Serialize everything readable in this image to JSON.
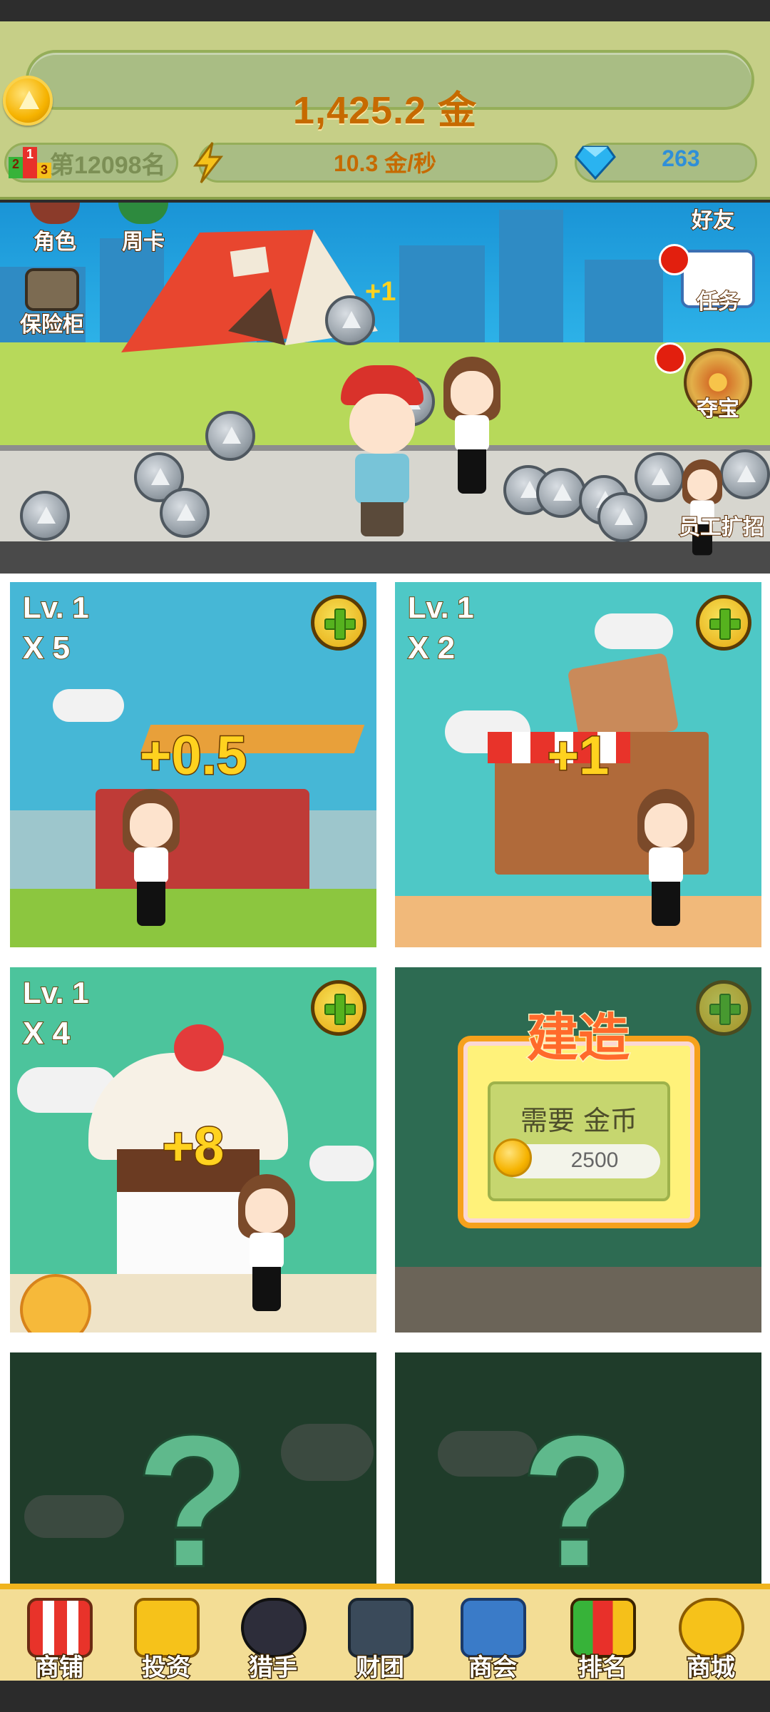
{
  "hud": {
    "coins": "1,425.2 金",
    "rank": "第12098名",
    "rank_badges": [
      "2",
      "1",
      "3"
    ],
    "speed": "10.3 金/秒",
    "gems": "263"
  },
  "scene": {
    "buttons": {
      "role": "角色",
      "weekly_card": "周卡",
      "safe": "保险柜",
      "friends": "好友",
      "tasks": "任务",
      "treasure": "夺宝",
      "recruit": "员工扩招"
    },
    "floating_gain": "+1"
  },
  "tiles": [
    {
      "level": "Lv. 1",
      "staff": "X 5",
      "gain": "+0.5"
    },
    {
      "level": "Lv. 1",
      "staff": "X 2",
      "gain": "+1"
    },
    {
      "level": "Lv. 1",
      "staff": "X 4",
      "gain": "+8"
    },
    {
      "build_title": "建造",
      "need_label": "需要 金币",
      "cost": "2500"
    },
    {
      "locked_symbol": "?"
    },
    {
      "locked_symbol": "?"
    }
  ],
  "nav": [
    {
      "label": "商铺",
      "icon": "shop-icon"
    },
    {
      "label": "投资",
      "icon": "invest-icon"
    },
    {
      "label": "猎手",
      "icon": "hunter-icon"
    },
    {
      "label": "财团",
      "icon": "consortium-icon"
    },
    {
      "label": "商会",
      "icon": "chamber-icon"
    },
    {
      "label": "排名",
      "icon": "ranking-icon"
    },
    {
      "label": "商城",
      "icon": "mall-icon"
    }
  ],
  "colors": {
    "hud_bg": "#c6cf87",
    "coin_text": "#c66a00",
    "gem_text": "#2f8fd8",
    "nav_bg": "#f3dd95",
    "build_title": "#ff6a2b"
  }
}
